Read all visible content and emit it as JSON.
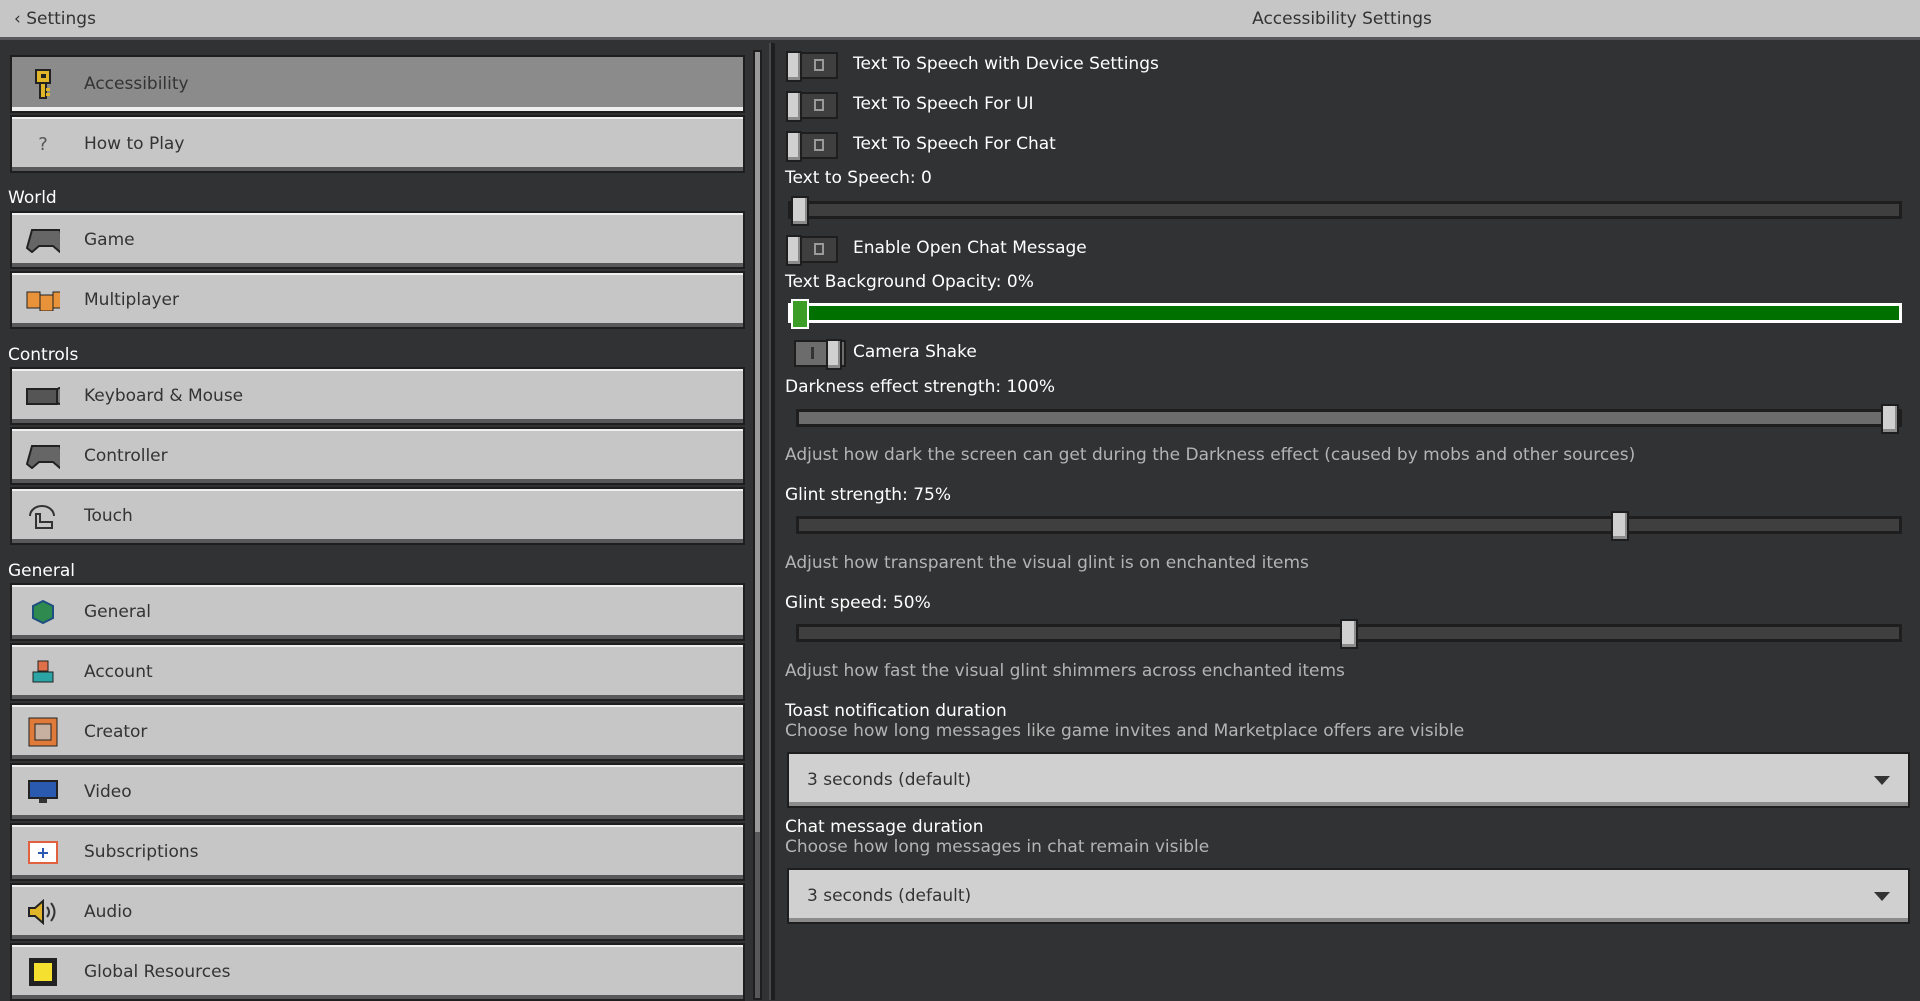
{
  "header": {
    "back_label": "Settings",
    "title": "Accessibility Settings"
  },
  "sidebar": {
    "top": [
      {
        "label": "Accessibility",
        "icon": "key-icon"
      },
      {
        "label": "How to Play",
        "icon": "question-icon"
      }
    ],
    "sections": [
      {
        "title": "World",
        "items": [
          {
            "label": "Game",
            "icon": "controller-icon"
          },
          {
            "label": "Multiplayer",
            "icon": "multiplayer-icon"
          }
        ]
      },
      {
        "title": "Controls",
        "items": [
          {
            "label": "Keyboard & Mouse",
            "icon": "keyboard-icon"
          },
          {
            "label": "Controller",
            "icon": "controller-icon"
          },
          {
            "label": "Touch",
            "icon": "touch-icon"
          }
        ]
      },
      {
        "title": "General",
        "items": [
          {
            "label": "General",
            "icon": "globe-icon"
          },
          {
            "label": "Account",
            "icon": "account-icon"
          },
          {
            "label": "Creator",
            "icon": "creator-icon"
          },
          {
            "label": "Video",
            "icon": "monitor-icon"
          },
          {
            "label": "Subscriptions",
            "icon": "subscriptions-icon"
          },
          {
            "label": "Audio",
            "icon": "speaker-icon"
          },
          {
            "label": "Global Resources",
            "icon": "resources-icon"
          }
        ]
      }
    ]
  },
  "settings": {
    "tts_device": {
      "label": "Text To Speech with Device Settings",
      "on": false
    },
    "tts_ui": {
      "label": "Text To Speech For UI",
      "on": false
    },
    "tts_chat": {
      "label": "Text To Speech For Chat",
      "on": false
    },
    "tts_level": {
      "label": "Text to Speech: 0",
      "value": 0
    },
    "open_chat": {
      "label": "Enable Open Chat Message",
      "on": false
    },
    "bg_opacity": {
      "label": "Text Background Opacity: 0%",
      "value": 0
    },
    "camera_shake": {
      "label": "Camera Shake",
      "on": true
    },
    "darkness": {
      "label": "Darkness effect strength: 100%",
      "value": 100,
      "desc": "Adjust how dark the screen can get during the Darkness effect (caused by mobs and other sources)"
    },
    "glint_strength": {
      "label": "Glint strength: 75%",
      "value": 75,
      "desc": "Adjust how transparent the visual glint is on enchanted items"
    },
    "glint_speed": {
      "label": "Glint speed: 50%",
      "value": 50,
      "desc": "Adjust how fast the visual glint shimmers across enchanted items"
    },
    "toast": {
      "label": "Toast notification duration",
      "desc": "Choose how long messages like game invites and Marketplace offers are visible",
      "value": "3 seconds (default)"
    },
    "chat_duration": {
      "label": "Chat message duration",
      "desc": "Choose how long messages in chat remain visible",
      "value": "3 seconds (default)"
    }
  },
  "colors": {
    "accent_green": "#007000",
    "panel": "#313233",
    "button": "#c6c6c6"
  }
}
